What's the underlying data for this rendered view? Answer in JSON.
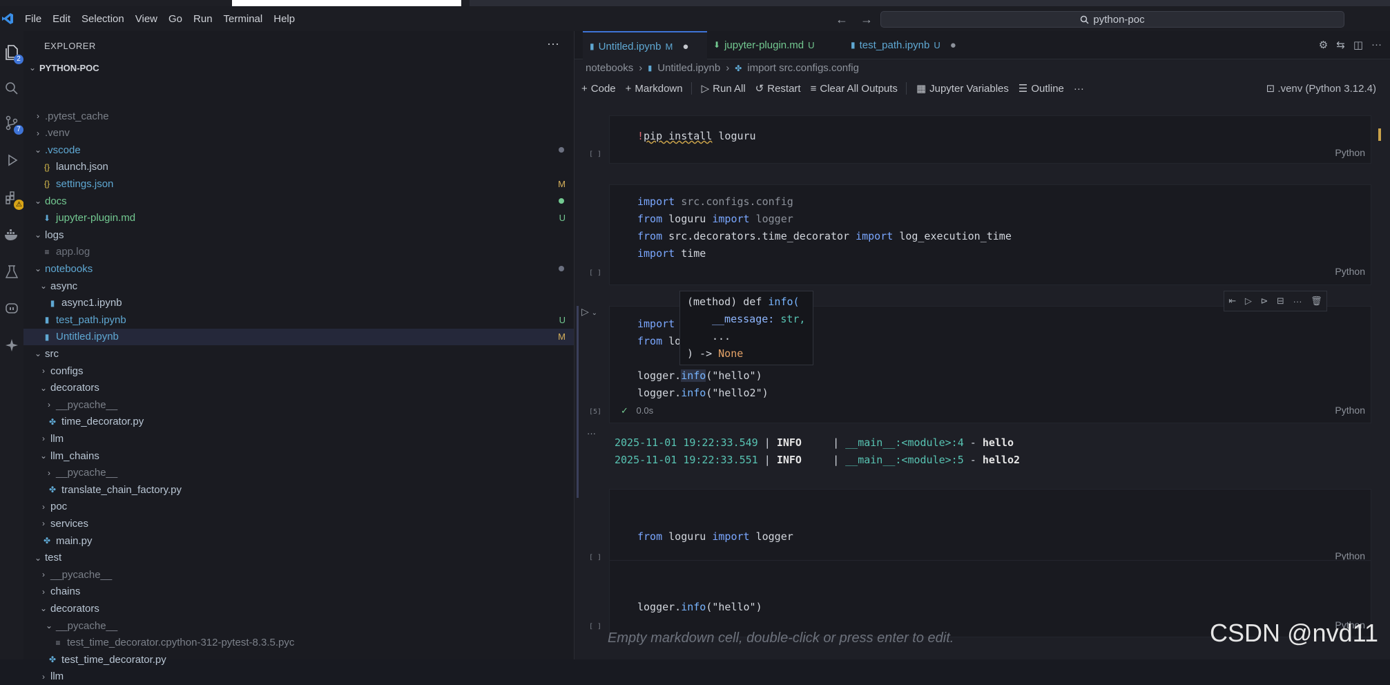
{
  "menubar": {
    "items": [
      "File",
      "Edit",
      "Selection",
      "View",
      "Go",
      "Run",
      "Terminal",
      "Help"
    ],
    "search": "python-poc"
  },
  "activity": {
    "explorer_badge": "2",
    "scm_badge": "7"
  },
  "explorer": {
    "title": "EXPLORER",
    "root": "PYTHON-POC",
    "rows": [
      {
        "label": ".pytest_cache",
        "indent": 1,
        "chevron": "right",
        "kind": "folder",
        "color": "#7b8089"
      },
      {
        "label": ".venv",
        "indent": 1,
        "chevron": "right",
        "kind": "folder",
        "color": "#7b8089"
      },
      {
        "label": ".vscode",
        "indent": 1,
        "chevron": "down",
        "kind": "folder",
        "color": "#5fa8d3",
        "dot": "#6b7080"
      },
      {
        "label": "launch.json",
        "indent": 2,
        "kind": "json",
        "color": "#b9c6d4"
      },
      {
        "label": "settings.json",
        "indent": 2,
        "kind": "json",
        "color": "#5fa8d3",
        "status": "M"
      },
      {
        "label": "docs",
        "indent": 1,
        "chevron": "down",
        "kind": "folder",
        "color": "#73c991",
        "dot": "#73c991"
      },
      {
        "label": "jupyter-plugin.md",
        "indent": 2,
        "kind": "md",
        "color": "#73c991",
        "status": "U"
      },
      {
        "label": "logs",
        "indent": 1,
        "chevron": "down",
        "kind": "folder",
        "color": "#b9c6d4"
      },
      {
        "label": "app.log",
        "indent": 2,
        "kind": "log",
        "color": "#6d727c"
      },
      {
        "label": "notebooks",
        "indent": 1,
        "chevron": "down",
        "kind": "folder",
        "color": "#5fa8d3",
        "dot": "#6b7080"
      },
      {
        "label": "async",
        "indent": 2,
        "chevron": "down",
        "kind": "folder",
        "color": "#b9c6d4"
      },
      {
        "label": "async1.ipynb",
        "indent": 3,
        "kind": "nb",
        "color": "#b9c6d4"
      },
      {
        "label": "test_path.ipynb",
        "indent": 2,
        "kind": "nb",
        "color": "#5fa8d3",
        "status": "U"
      },
      {
        "label": "Untitled.ipynb",
        "indent": 2,
        "kind": "nb",
        "color": "#5fa8d3",
        "status": "M",
        "selected": true
      },
      {
        "label": "src",
        "indent": 1,
        "chevron": "down",
        "kind": "folder",
        "color": "#b9c6d4"
      },
      {
        "label": "configs",
        "indent": 2,
        "chevron": "right",
        "kind": "folder",
        "color": "#b9c6d4"
      },
      {
        "label": "decorators",
        "indent": 2,
        "chevron": "down",
        "kind": "folder",
        "color": "#b9c6d4"
      },
      {
        "label": "__pycache__",
        "indent": 3,
        "chevron": "right",
        "kind": "folder",
        "color": "#7b8089"
      },
      {
        "label": "time_decorator.py",
        "indent": 3,
        "kind": "py",
        "color": "#b9c6d4"
      },
      {
        "label": "llm",
        "indent": 2,
        "chevron": "right",
        "kind": "folder",
        "color": "#b9c6d4"
      },
      {
        "label": "llm_chains",
        "indent": 2,
        "chevron": "down",
        "kind": "folder",
        "color": "#b9c6d4"
      },
      {
        "label": "__pycache__",
        "indent": 3,
        "chevron": "right",
        "kind": "folder",
        "color": "#7b8089"
      },
      {
        "label": "translate_chain_factory.py",
        "indent": 3,
        "kind": "py",
        "color": "#b9c6d4"
      },
      {
        "label": "poc",
        "indent": 2,
        "chevron": "right",
        "kind": "folder",
        "color": "#b9c6d4"
      },
      {
        "label": "services",
        "indent": 2,
        "chevron": "right",
        "kind": "folder",
        "color": "#b9c6d4"
      },
      {
        "label": "main.py",
        "indent": 2,
        "kind": "py",
        "color": "#b9c6d4"
      },
      {
        "label": "test",
        "indent": 1,
        "chevron": "down",
        "kind": "folder",
        "color": "#b9c6d4"
      },
      {
        "label": "__pycache__",
        "indent": 2,
        "chevron": "right",
        "kind": "folder",
        "color": "#7b8089"
      },
      {
        "label": "chains",
        "indent": 2,
        "chevron": "right",
        "kind": "folder",
        "color": "#b9c6d4"
      },
      {
        "label": "decorators",
        "indent": 2,
        "chevron": "down",
        "kind": "folder",
        "color": "#b9c6d4"
      },
      {
        "label": "__pycache__",
        "indent": 3,
        "chevron": "down",
        "kind": "folder",
        "color": "#7b8089"
      },
      {
        "label": "test_time_decorator.cpython-312-pytest-8.3.5.pyc",
        "indent": 4,
        "kind": "pyc",
        "color": "#7b8089"
      },
      {
        "label": "test_time_decorator.py",
        "indent": 3,
        "kind": "py",
        "color": "#b9c6d4"
      },
      {
        "label": "llm",
        "indent": 2,
        "chevron": "right",
        "kind": "folder",
        "color": "#b9c6d4"
      }
    ]
  },
  "tabs": [
    {
      "label": "Untitled.ipynb",
      "status": "M",
      "active": true
    },
    {
      "label": "jupyter-plugin.md",
      "status": "U"
    },
    {
      "label": "test_path.ipynb",
      "status": "U"
    }
  ],
  "breadcrumb": [
    "notebooks",
    "Untitled.ipynb",
    "import src.configs.config"
  ],
  "toolbar": {
    "code": "Code",
    "markdown": "Markdown",
    "run_all": "Run All",
    "restart": "Restart",
    "clear": "Clear All Outputs",
    "variables": "Jupyter Variables",
    "outline": "Outline",
    "kernel": ".venv (Python 3.12.4)"
  },
  "cells": {
    "lang": "Python",
    "empty_exec": "[ ]",
    "c3_exec": "[5]",
    "c3_time": "0.0s"
  },
  "output": {
    "line1": {
      "ts": "2025-11-01 19:22:33.549",
      "level": "INFO",
      "src": "__main__:<module>:4",
      "msg": "hello"
    },
    "line2": {
      "ts": "2025-11-01 19:22:33.551",
      "level": "INFO",
      "src": "__main__:<module>:5",
      "msg": "hello2"
    }
  },
  "tooltip": {
    "l1a": "(method) def ",
    "l1b": "info(",
    "l2a": "__message: ",
    "l2b": "str,",
    "l3": "...",
    "l4a": ") -> ",
    "l4b": "None"
  },
  "footer_markdown": "Empty markdown cell, double-click or press enter to edit.",
  "watermark": "CSDN @nvd11"
}
